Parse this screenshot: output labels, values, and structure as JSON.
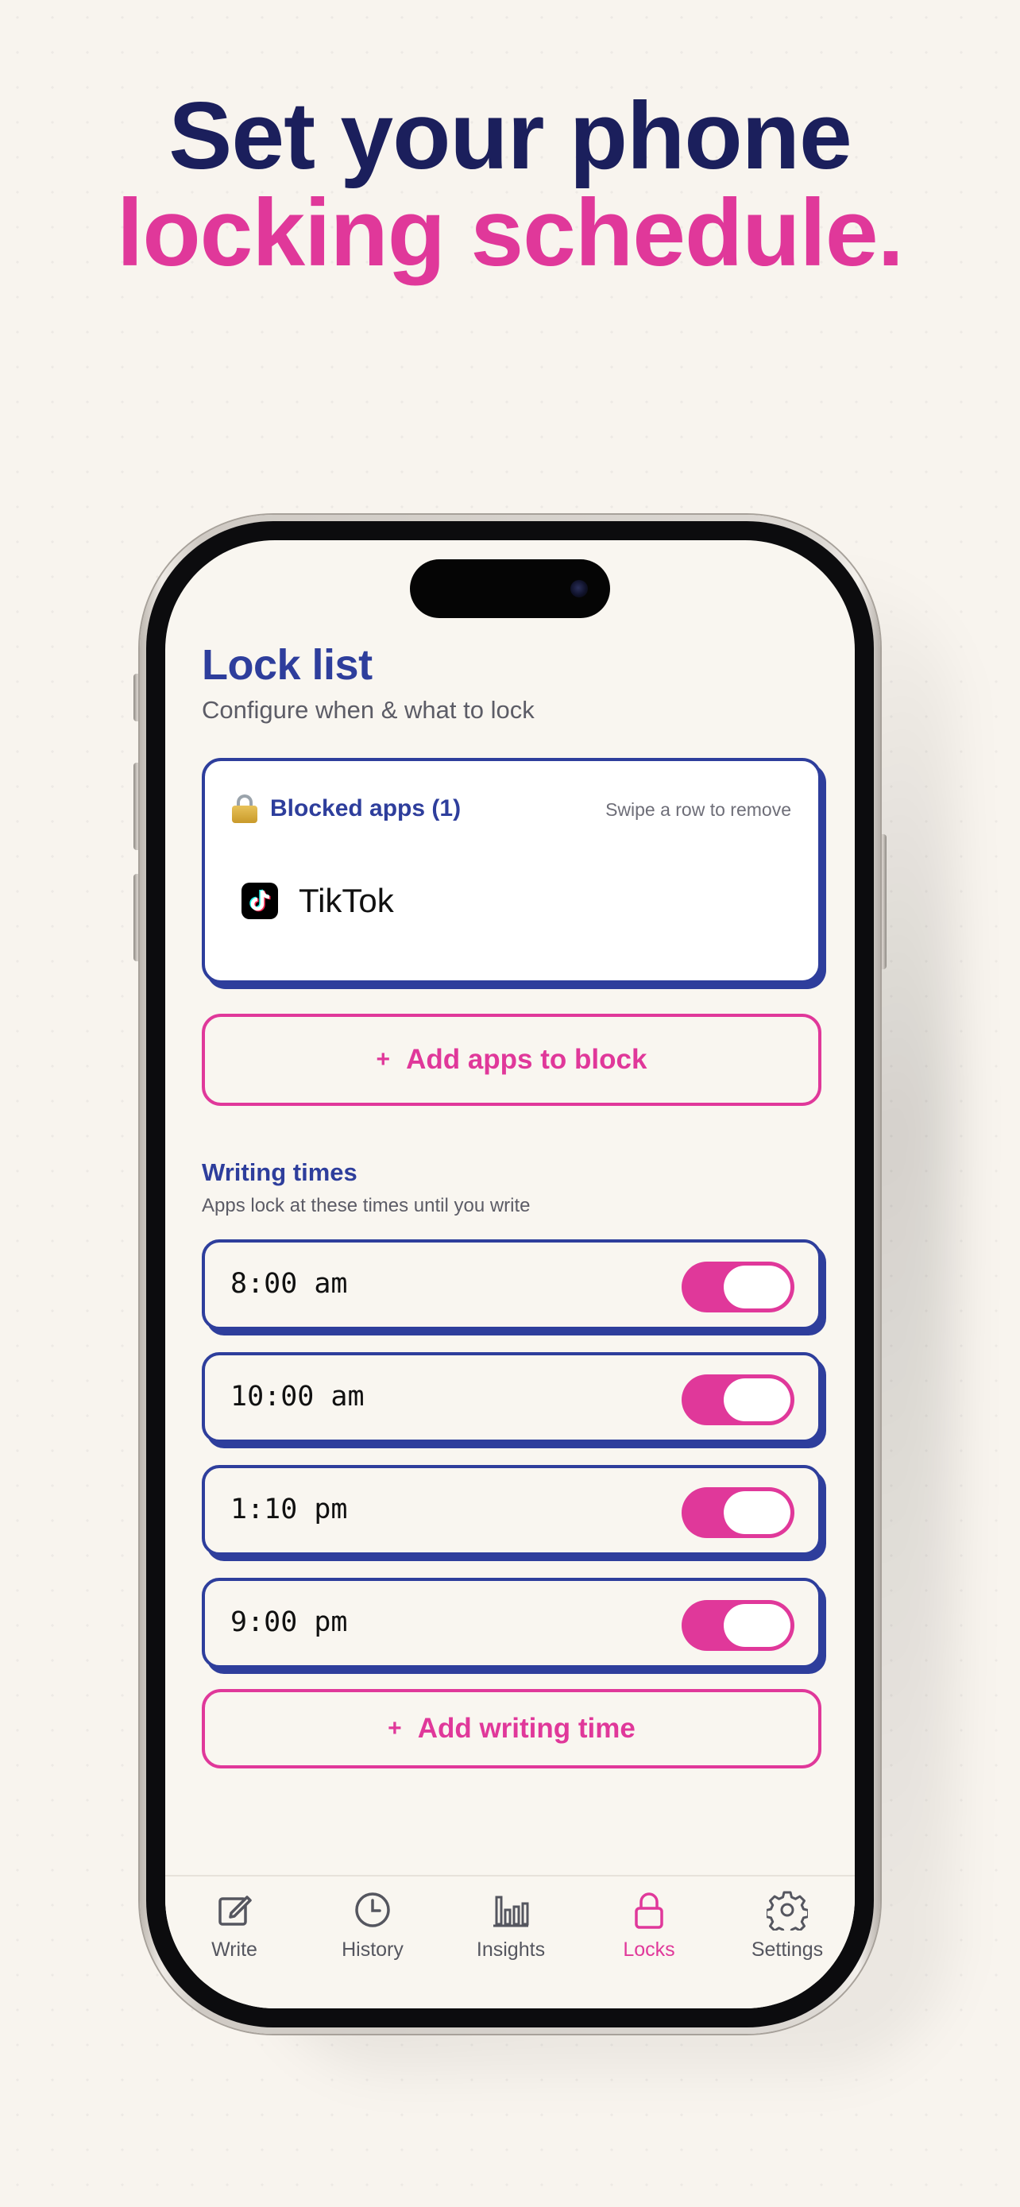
{
  "headline": {
    "line1": "Set your phone",
    "line2": "locking schedule."
  },
  "screen": {
    "title": "Lock list",
    "subtitle": "Configure when & what to lock",
    "blocked": {
      "title": "Blocked apps (1)",
      "hint": "Swipe a row to remove",
      "apps": [
        {
          "name": "TikTok",
          "icon": "tiktok-icon"
        }
      ]
    },
    "add_apps": {
      "plus": "+",
      "label": "Add apps to block"
    },
    "writing": {
      "title": "Writing times",
      "subtitle": "Apps lock at these times until you write",
      "times": [
        {
          "label": "8:00 am",
          "enabled": true
        },
        {
          "label": "10:00 am",
          "enabled": true
        },
        {
          "label": "1:10 pm",
          "enabled": true
        },
        {
          "label": "9:00 pm",
          "enabled": true
        }
      ]
    },
    "add_time": {
      "plus": "+",
      "label": "Add writing time"
    },
    "tabs": [
      {
        "label": "Write",
        "icon": "compose-icon",
        "active": false
      },
      {
        "label": "History",
        "icon": "clock-icon",
        "active": false
      },
      {
        "label": "Insights",
        "icon": "bar-chart-icon",
        "active": false
      },
      {
        "label": "Locks",
        "icon": "lock-icon",
        "active": true
      },
      {
        "label": "Settings",
        "icon": "gear-icon",
        "active": false
      }
    ]
  },
  "colors": {
    "navy": "#1b1f5c",
    "blue": "#2e3e9c",
    "pink": "#e0389a",
    "background": "#f8f4ee"
  }
}
